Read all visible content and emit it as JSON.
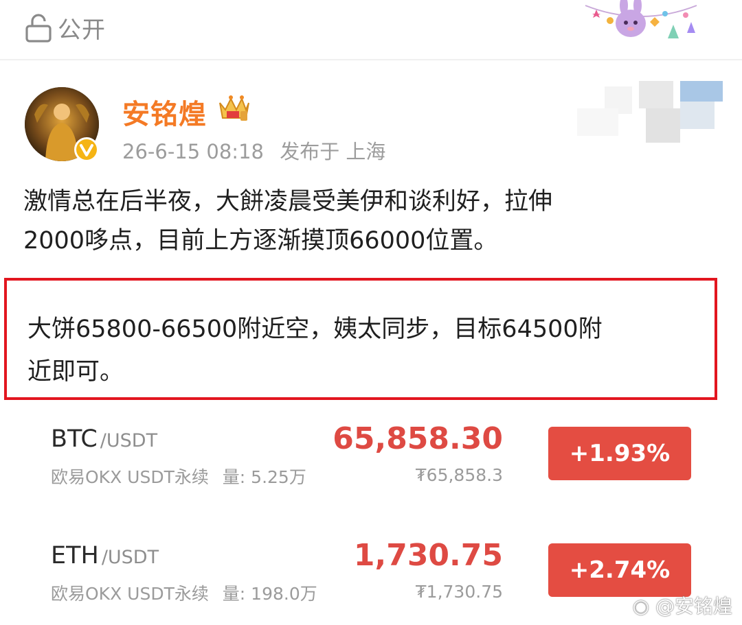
{
  "visibility": {
    "label": "公开",
    "icon": "lock-icon"
  },
  "author": {
    "name": "安铭煌",
    "time": "26-6-15 08:18",
    "location_label": "发布于 上海",
    "name_color": "#f47a25"
  },
  "post": {
    "line1": "激情总在后半夜，大餅凌晨受美伊和谈利好，拉伸",
    "line2": "2000哆点，目前上方逐渐摸顶66000位置。",
    "highlight_line1": "大饼65800-66500附近空，姨太同步，目标64500附",
    "highlight_line2": "近即可。"
  },
  "tickers": [
    {
      "symbol": "BTC",
      "quote": "/USDT",
      "exchange": "欧易OKX USDT永续",
      "volume_label": "量: 5.25万",
      "price": "65,858.30",
      "cny_price": "₮65,858.3",
      "change": "+1.93%"
    },
    {
      "symbol": "ETH",
      "quote": "/USDT",
      "exchange": "欧易OKX USDT永续",
      "volume_label": "量: 198.0万",
      "price": "1,730.75",
      "cny_price": "₮1,730.75",
      "change": "+2.74%"
    }
  ],
  "colors": {
    "up_red": "#e44d42",
    "price_red": "#de4a43",
    "highlight_border": "#e2161f"
  },
  "watermark": "@安铭煌"
}
